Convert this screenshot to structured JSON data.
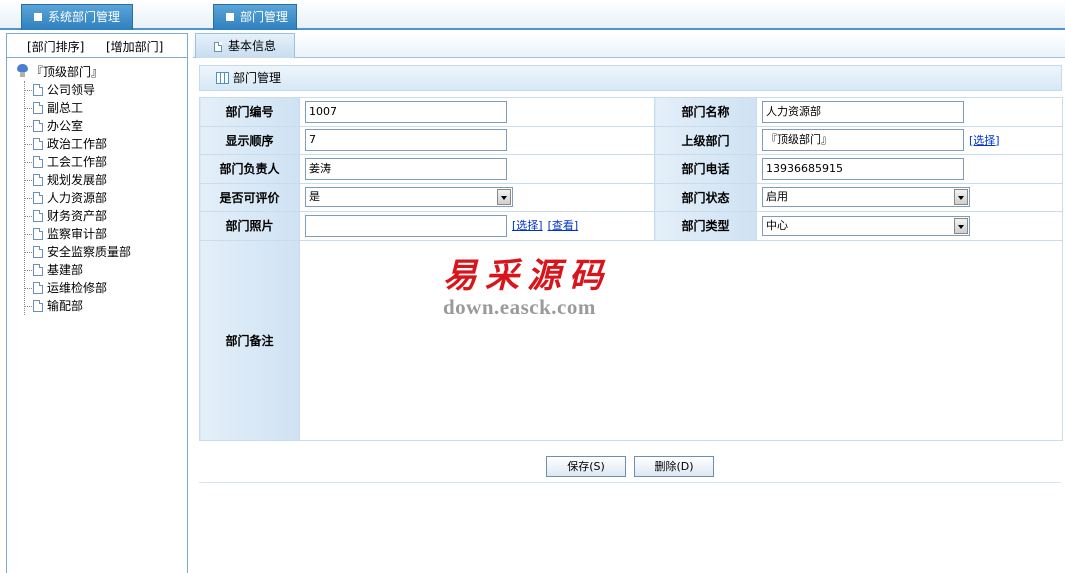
{
  "top_tabs": [
    {
      "label": "系统部门管理"
    },
    {
      "label": "部门管理"
    }
  ],
  "left_panel": {
    "links": [
      "[部门排序]",
      "[增加部门]"
    ],
    "tree_root": "『顶级部门』",
    "tree_items": [
      "公司领导",
      "副总工",
      "办公室",
      "政治工作部",
      "工会工作部",
      "规划发展部",
      "人力资源部",
      "财务资产部",
      "监察审计部",
      "安全监察质量部",
      "基建部",
      "运维检修部",
      "输配部"
    ]
  },
  "sub_tab": {
    "label": "基本信息"
  },
  "section": {
    "title": "部门管理"
  },
  "form": {
    "dept_code_label": "部门编号",
    "dept_code_value": "1007",
    "dept_name_label": "部门名称",
    "dept_name_value": "人力资源部",
    "order_label": "显示顺序",
    "order_value": "7",
    "parent_label": "上级部门",
    "parent_value": "『顶级部门』",
    "parent_select_link": "[选择]",
    "head_label": "部门负责人",
    "head_value": "姜涛",
    "phone_label": "部门电话",
    "phone_value": "13936685915",
    "evaluable_label": "是否可评价",
    "evaluable_value": "是",
    "status_label": "部门状态",
    "status_value": "启用",
    "photo_label": "部门照片",
    "photo_value": "",
    "photo_select_link": "[选择]",
    "photo_view_link": "[查看]",
    "type_label": "部门类型",
    "type_value": "中心",
    "remark_label": "部门备注",
    "remark_value": ""
  },
  "watermark": {
    "cn": "易采源码",
    "en": "down.easck.com"
  },
  "buttons": {
    "save": "保存(S)",
    "delete": "删除(D)"
  },
  "colors": {
    "tab_blue": "#2f7fbf",
    "label_bg": "#cfe2f3",
    "watermark_red": "#d9141b",
    "link_blue": "#0033cc"
  }
}
